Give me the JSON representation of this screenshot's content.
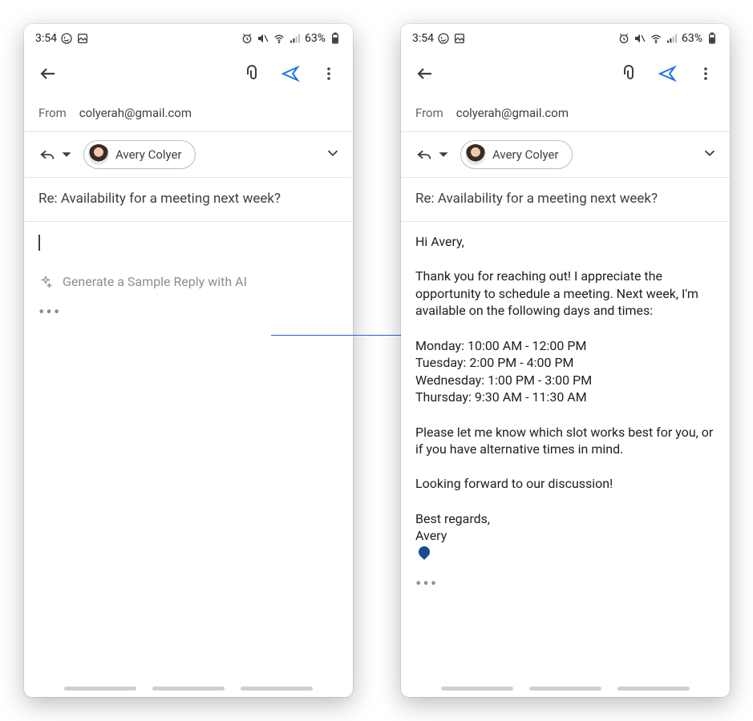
{
  "status": {
    "time": "3:54",
    "battery": "63%"
  },
  "toolbar": {},
  "from": {
    "label": "From",
    "value": "colyerah@gmail.com"
  },
  "to": {
    "name": "Avery Colyer"
  },
  "subject": "Re: Availability for a meeting next week?",
  "ai_prompt": "Generate a Sample Reply with AI",
  "thread_marker": "•••",
  "reply_body": "Hi Avery,\n\nThank you for reaching out! I appreciate the opportunity to schedule a meeting. Next week, I'm available on the following days and times:\n\nMonday: 10:00 AM - 12:00 PM\nTuesday: 2:00 PM - 4:00 PM\nWednesday: 1:00 PM - 3:00 PM\nThursday: 9:30 AM - 11:30 AM\n\nPlease let me know which slot works best for you, or if you have alternative times in mind.\n\nLooking forward to our discussion!\n\nBest regards,\nAvery"
}
